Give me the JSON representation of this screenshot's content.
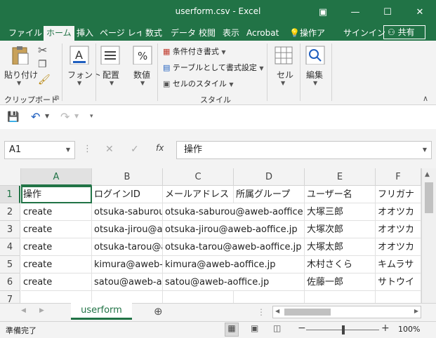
{
  "window": {
    "title": "userform.csv - Excel",
    "buttons": {
      "ribbon_display": "▣",
      "minimize": "—",
      "maximize": "☐",
      "close": "✕"
    }
  },
  "ribbon_tabs": [
    "ファイル",
    "ホーム",
    "挿入",
    "ページ レイアウト",
    "数式",
    "データ",
    "校閲",
    "表示",
    "Acrobat"
  ],
  "tell_me": "操作アシスト",
  "signin": "サインイン",
  "share": "共有",
  "ribbon": {
    "clipboard": {
      "paste": "貼り付け",
      "group": "クリップボード"
    },
    "font": {
      "label": "フォント"
    },
    "alignment": {
      "label": "配置"
    },
    "number": {
      "label": "数値"
    },
    "styles": {
      "conditional": "条件付き書式",
      "table": "テーブルとして書式設定",
      "cell_styles": "セルのスタイル",
      "group": "スタイル"
    },
    "cells": {
      "label": "セル"
    },
    "editing": {
      "label": "編集"
    }
  },
  "formula_bar": {
    "name_box": "A1",
    "fx": "fx",
    "value": "操作"
  },
  "columns": [
    "A",
    "B",
    "C",
    "D",
    "E",
    "F"
  ],
  "rows": [
    [
      "操作",
      "ログインID",
      "メールアドレス",
      "所属グループ",
      "ユーザー名",
      "フリガナ"
    ],
    [
      "create",
      "otsuka-saburou@aweb-aoffice.jp",
      "otsuka-saburou@aweb-aoffice.jp",
      "",
      "大塚三郎",
      "オオツカ"
    ],
    [
      "create",
      "otsuka-jirou@aweb-aoffice.jp",
      "otsuka-jirou@aweb-aoffice.jp",
      "",
      "大塚次郎",
      "オオツカ"
    ],
    [
      "create",
      "otsuka-tarou@aweb-aoffice.jp",
      "otsuka-tarou@aweb-aoffice.jp",
      "",
      "大塚太郎",
      "オオツカ"
    ],
    [
      "create",
      "kimura@aweb-aoffice.jp",
      "kimura@aweb-aoffice.jp",
      "",
      "木村さくら",
      "キムラサ"
    ],
    [
      "create",
      "satou@aweb-aoffice.jp",
      "satou@aweb-aoffice.jp",
      "",
      "佐藤一郎",
      "サトウイ"
    ],
    [
      "",
      "",
      "",
      "",
      "",
      ""
    ]
  ],
  "row_numbers": [
    "1",
    "2",
    "3",
    "4",
    "5",
    "6",
    "7"
  ],
  "sheet_tab": "userform",
  "status": {
    "ready": "準備完了",
    "zoom": "100%"
  }
}
